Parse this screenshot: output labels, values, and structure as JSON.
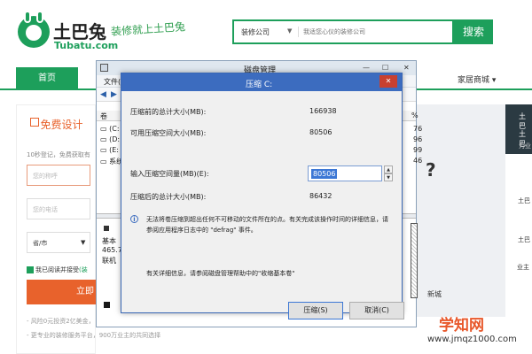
{
  "site": {
    "logo_name": "土巴兔",
    "logo_domain": "Tubatu.com",
    "slogan": "装修就上土巴兔",
    "search": {
      "category": "装修公司",
      "placeholder": "我适您心仪的装修公司",
      "button": "搜索"
    },
    "nav": {
      "home": "首页",
      "mall": "家居商城"
    },
    "form": {
      "title": "免费设计",
      "tip": "10秒登记，免费获取有",
      "name_placeholder": "您的称呼",
      "phone_placeholder": "您的电话",
      "city": "省/市",
      "agree": "我已阅读并接受",
      "agree_suffix": "(装",
      "submit": "立即",
      "promo1": "- 风险0元投资2亿美金，",
      "promo2": "- 更专业的装修服务平台，900万业主的共同选择"
    },
    "banner": {
      "question": "?",
      "caption": "新城"
    },
    "right_strip": {
      "t1": "土巴",
      "t2": "土巴",
      "t3": "为业",
      "t4": "土巴",
      "t5": "土巴",
      "t6": "业主"
    },
    "watermark": {
      "line1": "学知网",
      "line2": "www.jmqz1000.com"
    }
  },
  "disk_management": {
    "title": "磁盘管理",
    "menu_file": "文件(F)",
    "controls": {
      "minimize": "—",
      "maximize": "☐",
      "close": "✕"
    },
    "col_volume": "卷",
    "col_pct": "%",
    "rows": [
      {
        "label": "(C:",
        "value": "76"
      },
      {
        "label": "(D:",
        "value": "96"
      },
      {
        "label": "(E:",
        "value": "99"
      },
      {
        "label": "系统",
        "value": "46"
      }
    ],
    "disk": {
      "type": "基本",
      "size": "465.7",
      "status": "联机"
    }
  },
  "dialog": {
    "title": "压缩 C:",
    "fields": [
      {
        "label": "压缩前的总计大小(MB):",
        "value": "166938"
      },
      {
        "label": "可用压缩空间大小(MB):",
        "value": "80506"
      },
      {
        "label": "输入压缩空间量(MB)(E):",
        "value": "80506"
      },
      {
        "label": "压缩后的总计大小(MB):",
        "value": "86432"
      }
    ],
    "info_line1": "无法将卷压缩到超出任何不可移动的文件所在的点。有关完成该操作时间的详细信息，请",
    "info_line2": "参阅应用程序日志中的 \"defrag\" 事件。",
    "help": "有关详细信息，请参阅磁盘管理帮助中的\"收缩基本卷\"",
    "ok_button": "压缩(S)",
    "cancel_button": "取消(C)"
  }
}
